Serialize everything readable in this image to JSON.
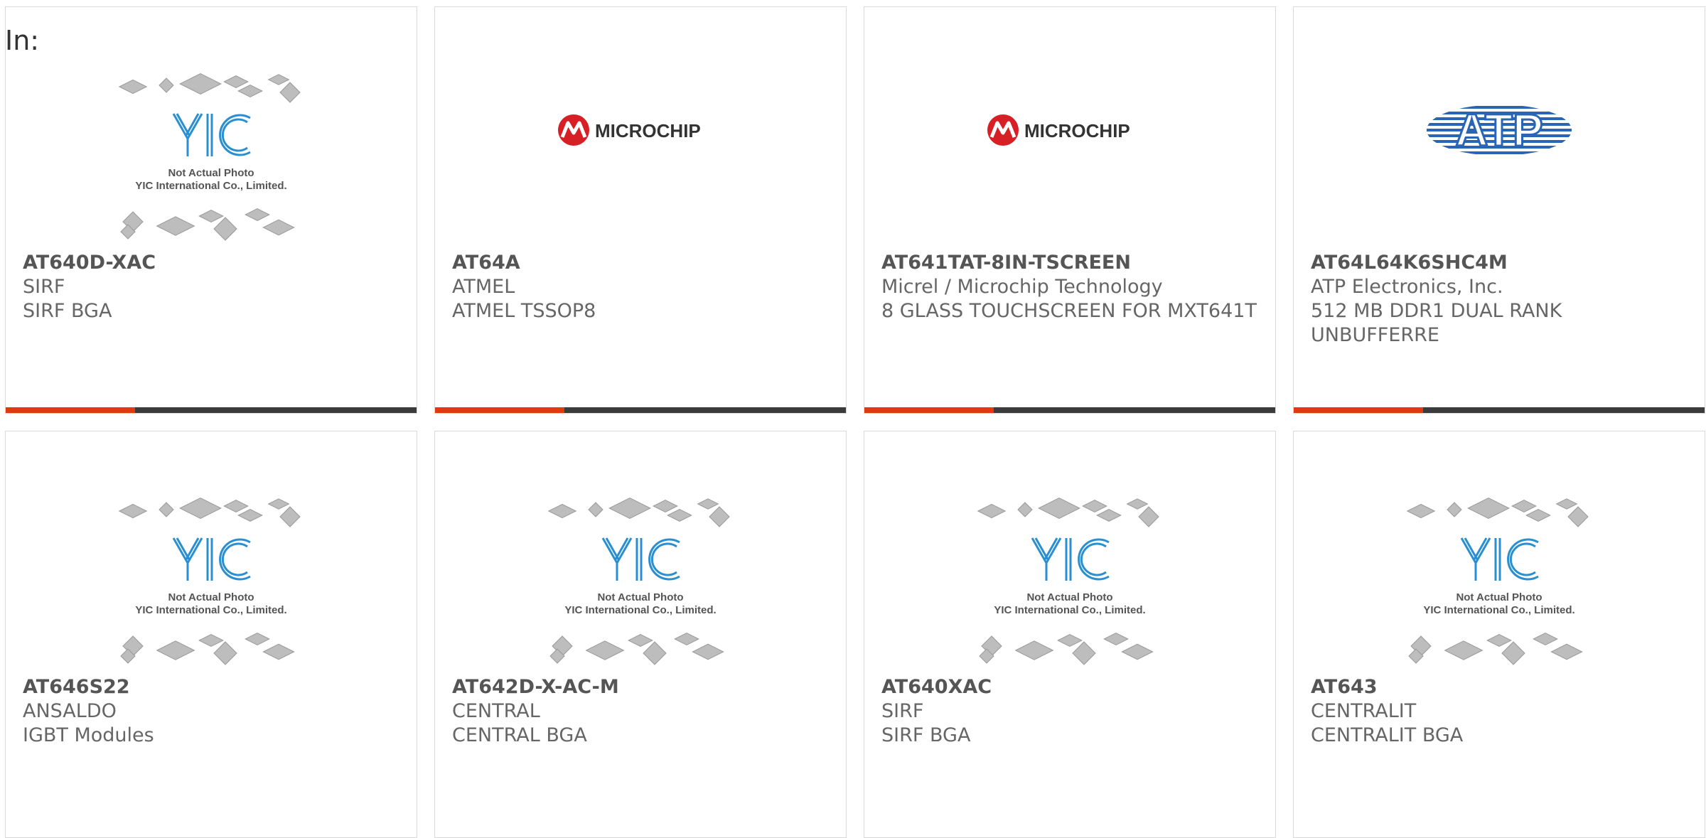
{
  "prefix_label": "In:",
  "colors": {
    "accent": "#e03a0e",
    "bar": "#3b3b3b",
    "yic_blue": "#2a8fd0",
    "microchip_red": "#d71f26",
    "atp_blue": "#2a64b4"
  },
  "placeholder": {
    "line1": "Not Actual Photo",
    "line2": "YIC International Co., Limited.",
    "logo": "YIC"
  },
  "logos": {
    "microchip": "MICROCHIP",
    "atp": "ATP"
  },
  "products": [
    {
      "part": "AT640D-XAC",
      "maker": "SIRF",
      "desc": "SIRF BGA",
      "image": "yic-placeholder"
    },
    {
      "part": "AT64A",
      "maker": "ATMEL",
      "desc": "ATMEL TSSOP8",
      "image": "microchip-logo"
    },
    {
      "part": "AT641TAT-8IN-TSCREEN",
      "maker": "Micrel / Microchip Technology",
      "desc": "8 GLASS TOUCHSCREEN FOR MXT641T",
      "image": "microchip-logo"
    },
    {
      "part": "AT64L64K6SHC4M",
      "maker": "ATP Electronics, Inc.",
      "desc": "512 MB DDR1 DUAL RANK UNBUFFERRE",
      "image": "atp-logo"
    },
    {
      "part": "AT646S22",
      "maker": "ANSALDO",
      "desc": "IGBT Modules",
      "image": "yic-placeholder"
    },
    {
      "part": "AT642D-X-AC-M",
      "maker": "CENTRAL",
      "desc": "CENTRAL BGA",
      "image": "yic-placeholder"
    },
    {
      "part": "AT640XAC",
      "maker": "SIRF",
      "desc": "SIRF BGA",
      "image": "yic-placeholder"
    },
    {
      "part": "AT643",
      "maker": "CENTRALIT",
      "desc": "CENTRALIT BGA",
      "image": "yic-placeholder"
    }
  ]
}
